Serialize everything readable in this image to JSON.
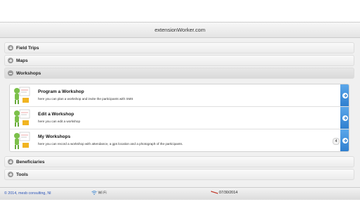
{
  "app": {
    "title": "extensionWorker.com"
  },
  "sections": [
    {
      "label": "Field Trips",
      "expanded": false
    },
    {
      "label": "Maps",
      "expanded": false
    },
    {
      "label": "Workshops",
      "expanded": true
    },
    {
      "label": "Beneficiaries",
      "expanded": false
    },
    {
      "label": "Tools",
      "expanded": false
    }
  ],
  "workshops": {
    "items": [
      {
        "title": "Program a Workshop",
        "description": "here you can plan a workshop and invite the participants with SMS",
        "count": ""
      },
      {
        "title": "Edit a Workshop",
        "description": "here you can edit a workshop",
        "count": ""
      },
      {
        "title": "My Workshops",
        "description": "here you can record a workshop with attendance, a gps location and a photograph of the participants.",
        "count": "4"
      }
    ]
  },
  "footer": {
    "copyright": "© 2014, mesb consulting, NI",
    "wifi": "Wi Fi",
    "date": "07/30/2014"
  },
  "colors": {
    "accent": "#2f7fcf",
    "link": "#2a53b8"
  }
}
